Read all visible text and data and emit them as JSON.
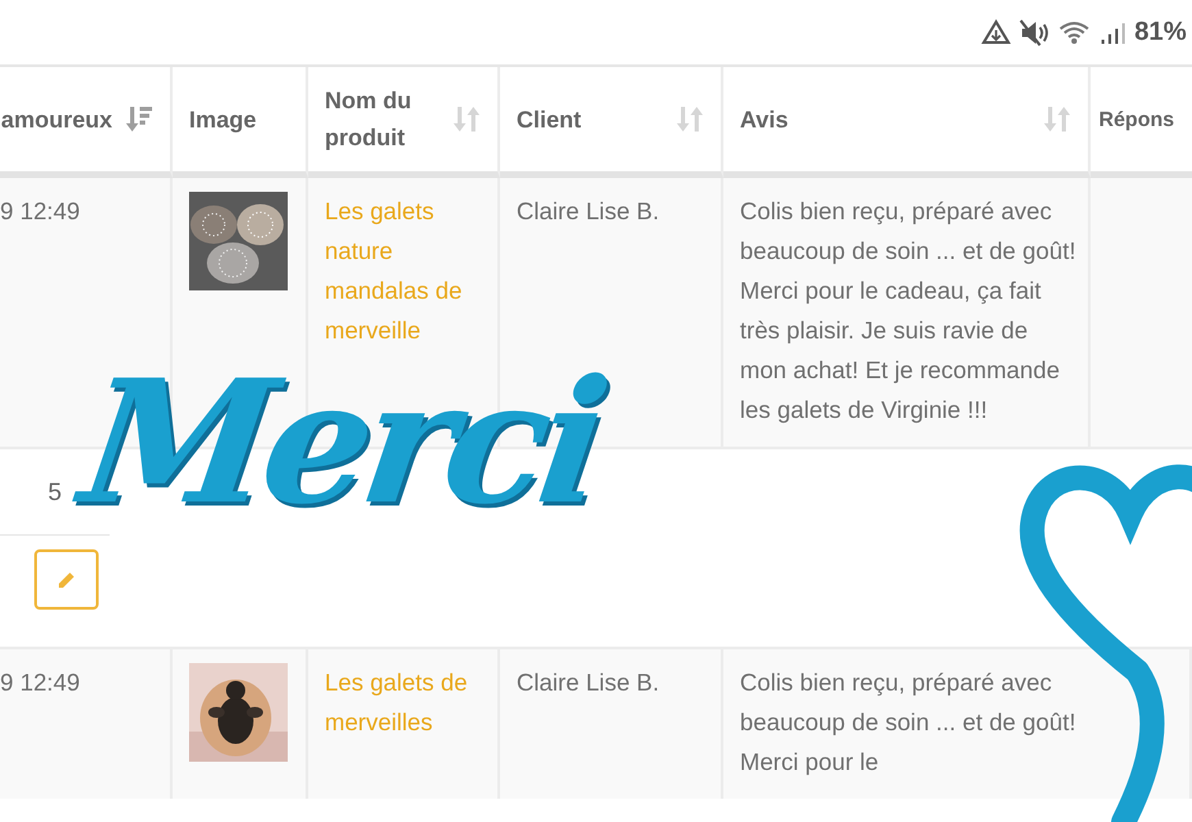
{
  "status_bar": {
    "battery": "81%"
  },
  "table": {
    "columns": [
      {
        "label": "amoureux",
        "sortable": true,
        "sorted": true
      },
      {
        "label": "Image",
        "sortable": false
      },
      {
        "label": "Nom du produit",
        "sortable": true,
        "sorted": false
      },
      {
        "label": "Client",
        "sortable": true,
        "sorted": false
      },
      {
        "label": "Avis",
        "sortable": true,
        "sorted": false
      },
      {
        "label": "Répons",
        "sortable": false
      }
    ],
    "rows": [
      {
        "date": "9 12:49",
        "product": "Les galets nature mandalas de merveille",
        "client": "Claire Lise B.",
        "review": "Colis bien reçu, préparé avec beaucoup de soin ... et de goût! Merci pour le cadeau, ça fait très plaisir. Je suis ravie de mon achat! Et je recommande les galets de Virginie !!!",
        "detail": {
          "count": "5",
          "editable": true
        }
      },
      {
        "date": "9 12:49",
        "product": "Les galets de merveilles",
        "client": "Claire Lise B.",
        "review": "Colis bien reçu, préparé avec beaucoup de soin ... et de goût! Merci pour le"
      }
    ]
  },
  "overlay": {
    "text": "Merci"
  }
}
